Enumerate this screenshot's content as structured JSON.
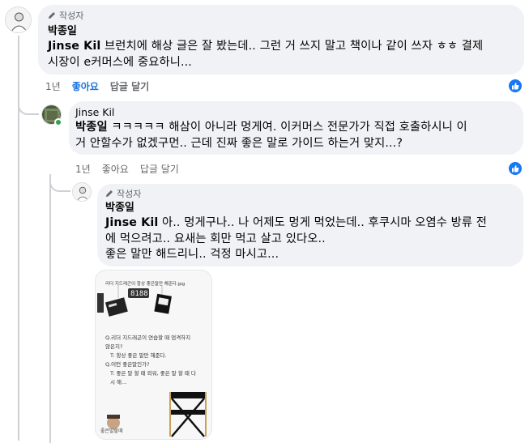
{
  "comments": [
    {
      "author_badge": "작성자",
      "name": "박종일",
      "tag": "Jinse Kil",
      "line1": "브런치에 해상 글은 잘 봤는데.. 그런 거 쓰지 말고 책이나 같이 쓰자 ㅎㅎ 결제",
      "line2": "시장이 e커머스에 중요하니...",
      "time": "1년",
      "like_label": "좋아요",
      "reply_label": "답글 달기"
    },
    {
      "name": "Jinse Kil",
      "tag": "박종일",
      "line1": "ㅋㅋㅋㅋㅋ 해삼이 아니라 멍게여. 이커머스 전문가가 직접 호출하시니 이",
      "line2": "거 안할수가 없겠구먼.. 근데 진짜 좋은 말로 가이드 하는거 맞지...?",
      "time": "1년",
      "like_label": "좋아요",
      "reply_label": "답글 달기"
    },
    {
      "author_badge": "작성자",
      "name": "박종일",
      "tag": "Jinse Kil",
      "line1": "아.. 멍게구나.. 나 어제도 멍게 먹었는데.. 후쿠시마 오염수 방류 전",
      "line2": "에 먹으려고.. 요새는 회만 먹고 살고 있다오..",
      "line3": "좋은 말만 해드리니.. 걱정 마시고..."
    }
  ],
  "meme": {
    "caption": "리더 지드래곤이 항상 좋은말만 해준다.jpg",
    "q1a": "Q.리더 지드래곤이 연습할 때 엄격하지",
    "q1b": "않은지?",
    "a1": "T: 항상 좋은 말만 해준다.",
    "q2": "Q.어떤 좋은말인가?",
    "a2a": "T: 좋은 말 할 때 외워, 좋은 말 할 때 다",
    "a2b": "시 해...",
    "footer": "좋은말할때"
  },
  "colors": {
    "bubble": "#f0f2f5",
    "like_blue": "#1877f2",
    "liked_text": "#1b74e4",
    "meta_text": "#65676b"
  }
}
